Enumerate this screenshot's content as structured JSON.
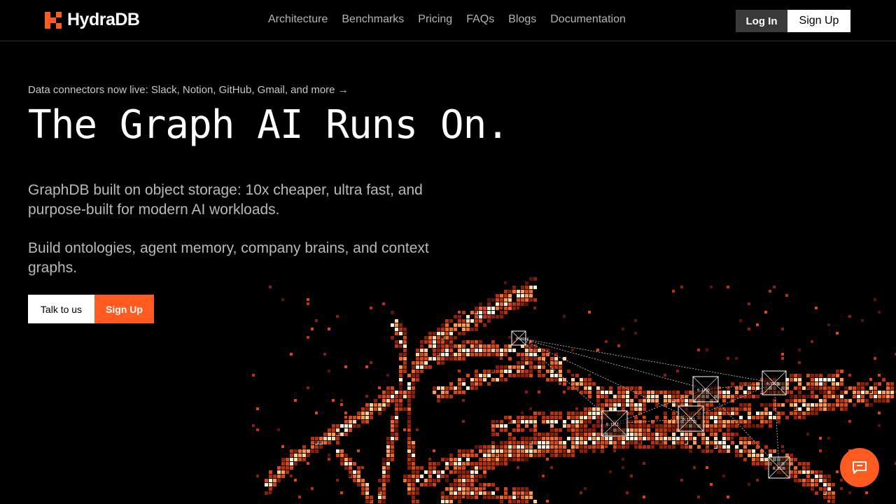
{
  "brand": {
    "name": "HydraDB",
    "accent": "#ff5a1f"
  },
  "nav": {
    "items": [
      "Architecture",
      "Benchmarks",
      "Pricing",
      "FAQs",
      "Blogs",
      "Documentation"
    ],
    "login_label": "Log In",
    "signup_label": "Sign Up"
  },
  "hero": {
    "announcement": "Data connectors now live: Slack, Notion, GitHub, Gmail, and more →",
    "headline": "The Graph AI Runs On.",
    "paragraph1": "GraphDB built on object storage: 10x cheaper, ultra fast, and purpose-built for modern AI workloads.",
    "paragraph2": "Build ontologies, agent memory, company brains, and context graphs.",
    "talk_label": "Talk to us",
    "signup_label": "Sign Up"
  },
  "graph_nodes": [
    "0.0154",
    "0.1495",
    "0.1711",
    "0.7125",
    "0.1511",
    "0.1326"
  ],
  "chat": {
    "icon": "chat-bubble-icon"
  }
}
